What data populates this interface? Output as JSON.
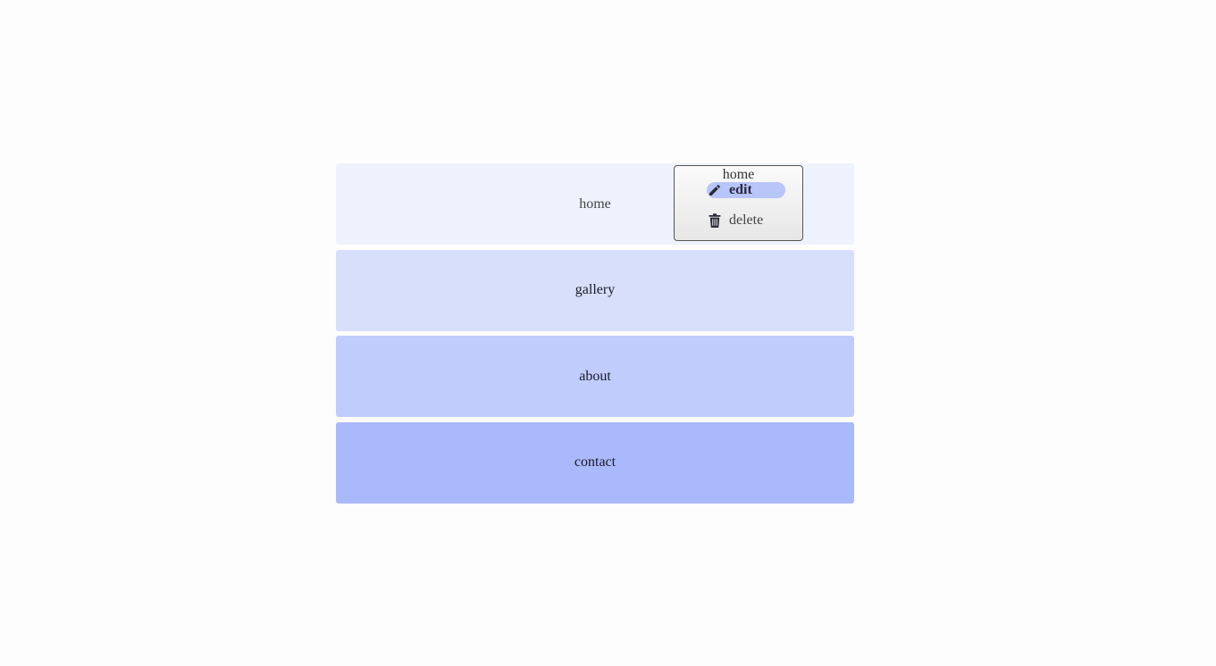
{
  "nav": {
    "items": [
      {
        "label": "home"
      },
      {
        "label": "gallery"
      },
      {
        "label": "about"
      },
      {
        "label": "contact"
      }
    ]
  },
  "context_menu": {
    "title": "home",
    "items": [
      {
        "label": "edit",
        "icon": "pencil-icon",
        "highlighted": true
      },
      {
        "label": "delete",
        "icon": "trash-icon",
        "highlighted": false
      }
    ]
  },
  "colors": {
    "home_bg": "#eef2fc",
    "gallery_bg": "#d7dffa",
    "about_bg": "#c0ccfc",
    "contact_bg": "#aab9fc",
    "menu_highlight": "#b8c5f8"
  }
}
